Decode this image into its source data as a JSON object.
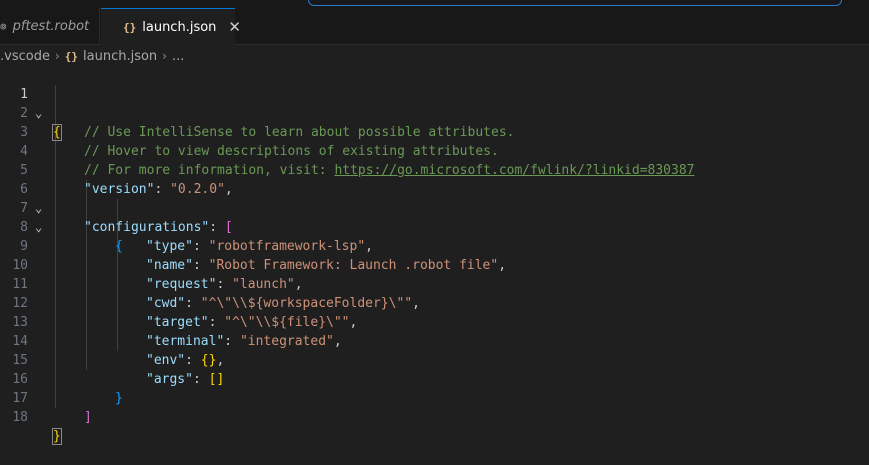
{
  "tabs": [
    {
      "icon": "⊚",
      "label": "pftest.robot",
      "active": false
    },
    {
      "icon": "{}",
      "label": "launch.json",
      "active": true,
      "close": "✕"
    }
  ],
  "breadcrumb": {
    "folder": ".vscode",
    "file_icon": "{}",
    "file": "launch.json",
    "tail": "..."
  },
  "editor": {
    "line_numbers": [
      "1",
      "2",
      "3",
      "4",
      "5",
      "6",
      "7",
      "8",
      "9",
      "10",
      "11",
      "12",
      "13",
      "14",
      "15",
      "16",
      "17",
      "18"
    ],
    "lines": {
      "l1_brace": "{",
      "l2_comment": "// Use IntelliSense to learn about possible attributes.",
      "l3_comment": "// Hover to view descriptions of existing attributes.",
      "l4_comment": "// For more information, visit: ",
      "l4_link": "https://go.microsoft.com/fwlink/?linkid=830387",
      "l5_key": "\"version\"",
      "l5_val": "\"0.2.0\"",
      "l6_key": "\"configurations\"",
      "l6_bracket": "[",
      "l7_brace": "{",
      "l8_key": "\"type\"",
      "l8_val": "\"robotframework-lsp\"",
      "l9_key": "\"name\"",
      "l9_val": "\"Robot Framework: Launch .robot file\"",
      "l10_key": "\"request\"",
      "l10_val": "\"launch\"",
      "l11_key": "\"cwd\"",
      "l11_val": "\"^\\\"\\\\${workspaceFolder}\\\"\"",
      "l12_key": "\"target\"",
      "l12_val": "\"^\\\"\\\\${file}\\\"\"",
      "l13_key": "\"terminal\"",
      "l13_val": "\"integrated\"",
      "l14_key": "\"env\"",
      "l14_val": "{}",
      "l15_key": "\"args\"",
      "l15_val": "[]",
      "l16_brace": "}",
      "l17_bracket": "]",
      "l18_brace": "}"
    },
    "colon": ": ",
    "comma": ","
  },
  "colors": {
    "background": "#1f1f1f",
    "comment": "#6a9955",
    "key": "#9cdcfe",
    "string": "#ce9178",
    "bracket_level1": "#ffd700",
    "bracket_level2": "#da70d6",
    "bracket_level3": "#179fff",
    "active_tab_border": "#0078d4"
  }
}
